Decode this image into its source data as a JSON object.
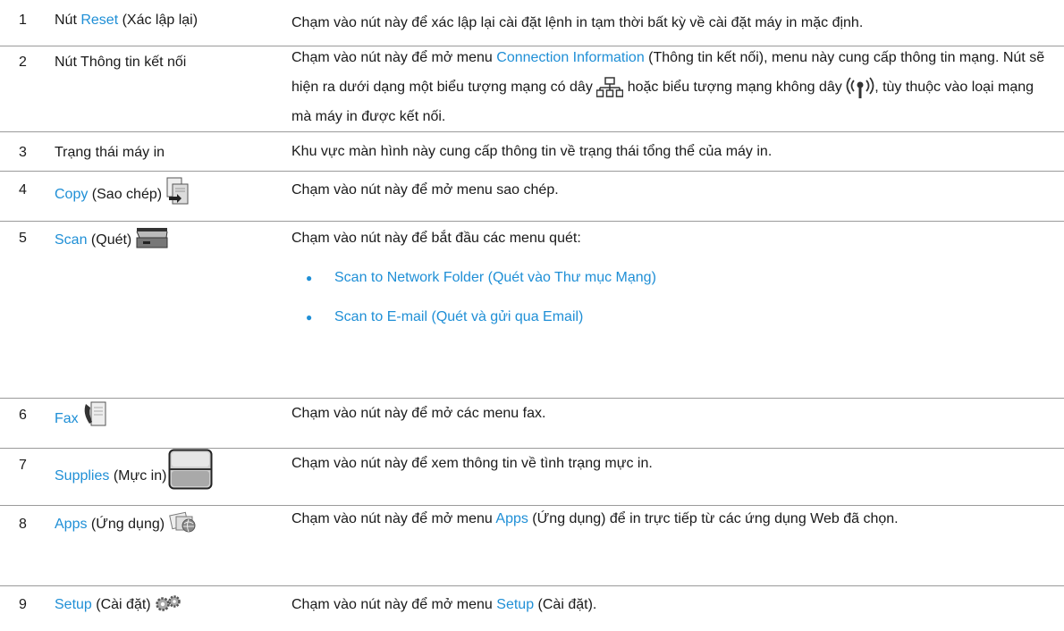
{
  "rows": [
    {
      "num": "1",
      "item_pre": "Nút ",
      "item_link": "Reset",
      "item_post": " (Xác lập lại)",
      "desc": "Chạm vào nút này để xác lập lại cài đặt lệnh in tạm thời bất kỳ về cài đặt máy in mặc định."
    },
    {
      "num": "2",
      "item": "Nút Thông tin kết nối",
      "desc_1": "Chạm vào nút này để mở menu ",
      "desc_link": "Connection Information",
      "desc_2": " (Thông tin kết nối), menu này cung cấp thông tin mạng. Nút sẽ hiện ra dưới dạng một biểu tượng mạng có dây ",
      "desc_3": " hoặc biểu tượng mạng không dây ",
      "desc_4": ", tùy thuộc vào loại mạng mà máy in được kết nối."
    },
    {
      "num": "3",
      "item": "Trạng thái máy in",
      "desc": "Khu vực màn hình này cung cấp thông tin về trạng thái tổng thể của máy in."
    },
    {
      "num": "4",
      "item_link": "Copy",
      "item_post": " (Sao chép)",
      "desc": "Chạm vào nút này để mở menu sao chép."
    },
    {
      "num": "5",
      "item_link": "Scan",
      "item_post": " (Quét)",
      "desc": "Chạm vào nút này để bắt đầu các menu quét:",
      "bullets": [
        "Scan to Network Folder (Quét vào Thư mục Mạng)",
        "Scan to E-mail (Quét và gửi qua Email)"
      ]
    },
    {
      "num": "6",
      "item_link": "Fax",
      "desc": "Chạm vào nút này để mở các menu fax."
    },
    {
      "num": "7",
      "item_link": "Supplies",
      "item_post": " (Mực in)",
      "desc": "Chạm vào nút này để xem thông tin về tình trạng mực in."
    },
    {
      "num": "8",
      "item_link": "Apps",
      "item_post": " (Ứng dụng)",
      "desc_1": "Chạm vào nút này để mở menu ",
      "desc_link": "Apps",
      "desc_2": " (Ứng dụng) để in trực tiếp từ các ứng dụng Web đã chọn."
    },
    {
      "num": "9",
      "item_link": "Setup",
      "item_post": " (Cài đặt)",
      "desc_1": "Chạm vào nút này để mở menu ",
      "desc_link": "Setup",
      "desc_2": " (Cài đặt)."
    }
  ],
  "colors": {
    "link": "#1f8fd6",
    "rule": "#9a9a9a",
    "text": "#1a1a1a"
  },
  "icons": [
    "wired-network-icon",
    "wireless-network-icon",
    "copy-icon",
    "scan-icon",
    "fax-icon",
    "supplies-icon",
    "apps-icon",
    "setup-icon"
  ]
}
